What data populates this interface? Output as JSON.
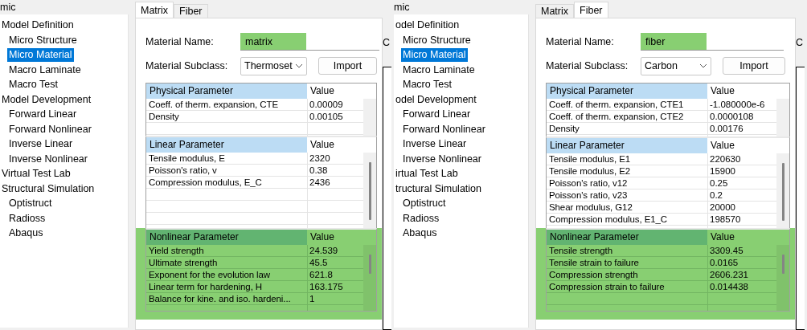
{
  "panels": [
    {
      "tree_title": "mic",
      "tree": [
        {
          "label": "Model Definition",
          "selected": false,
          "children": [
            {
              "label": "Micro Structure",
              "selected": false
            },
            {
              "label": "Micro Material",
              "selected": true
            },
            {
              "label": "Macro Laminate",
              "selected": false
            },
            {
              "label": "Macro Test",
              "selected": false
            }
          ]
        },
        {
          "label": "Model Development",
          "selected": false,
          "children": [
            {
              "label": "Forward Linear",
              "selected": false
            },
            {
              "label": "Forward Nonlinear",
              "selected": false
            },
            {
              "label": "Inverse Linear",
              "selected": false
            },
            {
              "label": "Inverse Nonlinear",
              "selected": false
            }
          ]
        },
        {
          "label": "Virtual Test Lab",
          "selected": false
        },
        {
          "label": "Structural Simulation",
          "selected": false,
          "children": [
            {
              "label": "Optistruct",
              "selected": false
            },
            {
              "label": "Radioss",
              "selected": false
            },
            {
              "label": "Abaqus",
              "selected": false
            }
          ]
        }
      ],
      "tabs": [
        {
          "label": "Matrix",
          "selected": true
        },
        {
          "label": "Fiber",
          "selected": false
        }
      ],
      "material_name_label": "Material Name:",
      "material_name": "matrix",
      "name_highlighted": true,
      "subclass_label": "Material Subclass:",
      "subclass": "Thermoset",
      "import_button": "Import",
      "edge_label": "C",
      "tables": [
        {
          "header": "Physical Parameter",
          "value_header": "Value",
          "highlighted": false,
          "rows": [
            [
              "Coeff. of therm. expansion, CTE",
              "0.00009"
            ],
            [
              "Density",
              "0.00105"
            ]
          ]
        },
        {
          "header": "Linear Parameter",
          "value_header": "Value",
          "highlighted": false,
          "rows": [
            [
              "Tensile modulus, E",
              "2320"
            ],
            [
              "Poisson's ratio, v",
              "0.38"
            ],
            [
              "Compression modulus, E_C",
              "2436"
            ]
          ]
        },
        {
          "header": "Nonlinear Parameter",
          "value_header": "Value",
          "highlighted": true,
          "rows": [
            [
              "Yield strength",
              "24.539"
            ],
            [
              "Ultimate strength",
              "45.5"
            ],
            [
              "Exponent for the evolution law",
              "621.8"
            ],
            [
              "Linear term for hardening, H",
              "163.175"
            ],
            [
              "Balance for kine. and iso. hardeni...",
              "1"
            ]
          ]
        }
      ]
    },
    {
      "tree_title": "mic",
      "tree": [
        {
          "label": "odel Definition",
          "selected": false,
          "children": [
            {
              "label": "Micro Structure",
              "selected": false
            },
            {
              "label": "Micro Material",
              "selected": true
            },
            {
              "label": "Macro Laminate",
              "selected": false
            },
            {
              "label": "Macro Test",
              "selected": false
            }
          ]
        },
        {
          "label": "odel Development",
          "selected": false,
          "children": [
            {
              "label": "Forward Linear",
              "selected": false
            },
            {
              "label": "Forward Nonlinear",
              "selected": false
            },
            {
              "label": "Inverse Linear",
              "selected": false
            },
            {
              "label": "Inverse Nonlinear",
              "selected": false
            }
          ]
        },
        {
          "label": "irtual Test Lab",
          "selected": false
        },
        {
          "label": "tructural Simulation",
          "selected": false,
          "children": [
            {
              "label": "Optistruct",
              "selected": false
            },
            {
              "label": "Radioss",
              "selected": false
            },
            {
              "label": "Abaqus",
              "selected": false
            }
          ]
        }
      ],
      "tabs": [
        {
          "label": "Matrix",
          "selected": false
        },
        {
          "label": "Fiber",
          "selected": true
        }
      ],
      "material_name_label": "Material Name:",
      "material_name": "fiber",
      "name_highlighted": true,
      "subclass_label": "Material Subclass:",
      "subclass": "Carbon",
      "import_button": "Import",
      "edge_label": "C",
      "tables": [
        {
          "header": "Physical Parameter",
          "value_header": "Value",
          "highlighted": false,
          "rows": [
            [
              "Coeff. of therm. expansion, CTE1",
              "-1.080000e-6"
            ],
            [
              "Coeff. of therm. expansion, CTE2",
              "0.0000108"
            ],
            [
              "Density",
              "0.00176"
            ]
          ]
        },
        {
          "header": "Linear Parameter",
          "value_header": "Value",
          "highlighted": false,
          "rows": [
            [
              "Tensile modulus, E1",
              "220630"
            ],
            [
              "Tensile modulus, E2",
              "15900"
            ],
            [
              "Poisson's ratio, v12",
              "0.25"
            ],
            [
              "Poisson's ratio, v23",
              "0.2"
            ],
            [
              "Shear modulus, G12",
              "20000"
            ],
            [
              "Compression modulus, E1_C",
              "198570"
            ]
          ]
        },
        {
          "header": "Nonlinear Parameter",
          "value_header": "Value",
          "highlighted": true,
          "rows": [
            [
              "Tensile strength",
              "3309.45"
            ],
            [
              "Tensile strain to failure",
              "0.0165"
            ],
            [
              "Compression strength",
              "2606.231"
            ],
            [
              "Compression strain to failure",
              "0.014438"
            ]
          ]
        }
      ]
    }
  ]
}
